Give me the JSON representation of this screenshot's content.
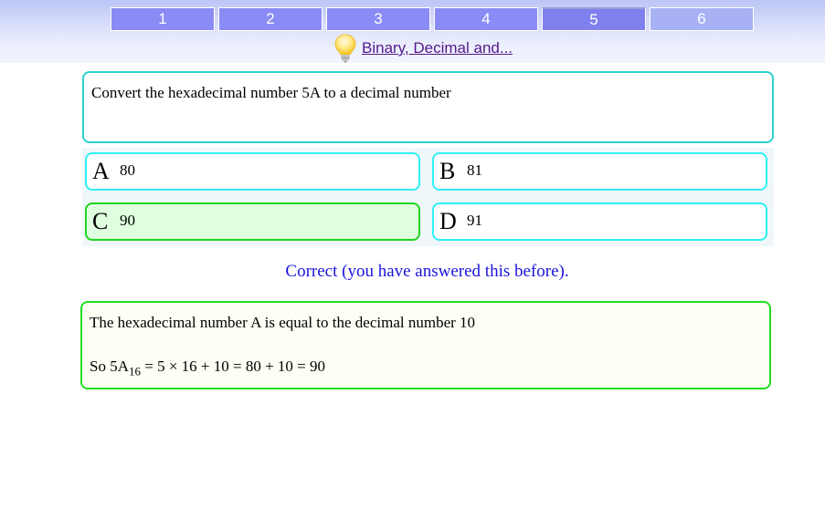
{
  "tabs": [
    {
      "label": "1",
      "state": "done"
    },
    {
      "label": "2",
      "state": "done"
    },
    {
      "label": "3",
      "state": "done"
    },
    {
      "label": "4",
      "state": "done"
    },
    {
      "label": "5",
      "state": "active"
    },
    {
      "label": "6",
      "state": "future"
    }
  ],
  "hint": {
    "icon": "lightbulb-icon",
    "link_text": "Binary, Decimal and..."
  },
  "question": {
    "text": "Convert the hexadecimal number 5A to a decimal number"
  },
  "answers": [
    {
      "letter": "A",
      "value": "80"
    },
    {
      "letter": "B",
      "value": "81"
    },
    {
      "letter": "C",
      "value": "90",
      "correct": true
    },
    {
      "letter": "D",
      "value": "91"
    }
  ],
  "feedback": {
    "text": "Correct (you have answered this before).",
    "color": "#1a14dd"
  },
  "explanation": {
    "line1": "The hexadecimal number A is equal to the decimal number 10",
    "line2_prefix": "So 5A",
    "line2_subscript": "16",
    "line2_suffix": " = 5 × 16 + 10 = 80 + 10 = 90"
  },
  "colors": {
    "tab": "#8b8bf5",
    "tab_future": "#a9b1f5",
    "question_border": "#2ad3cf",
    "answer_border": "#2ef0f6",
    "correct_border": "#1fd620",
    "correct_fill": "#dfffdf",
    "explain_border": "#1fdf1f"
  }
}
